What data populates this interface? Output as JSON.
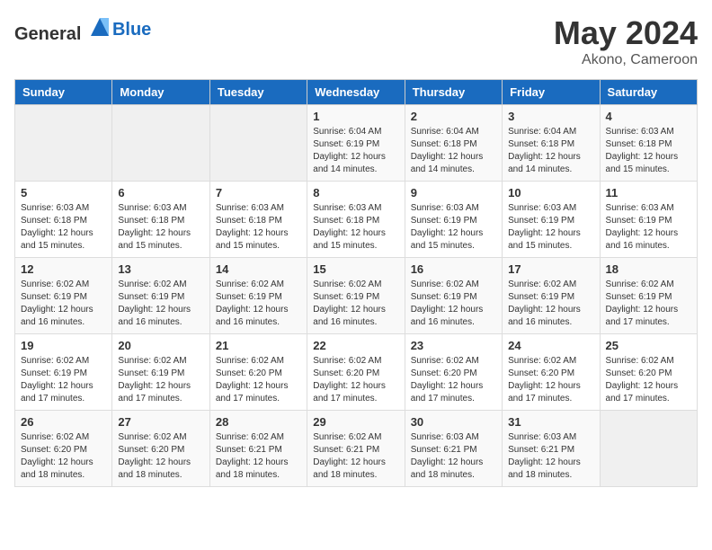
{
  "header": {
    "logo_general": "General",
    "logo_blue": "Blue",
    "month_year": "May 2024",
    "location": "Akono, Cameroon"
  },
  "days_of_week": [
    "Sunday",
    "Monday",
    "Tuesday",
    "Wednesday",
    "Thursday",
    "Friday",
    "Saturday"
  ],
  "weeks": [
    [
      {
        "day": "",
        "info": ""
      },
      {
        "day": "",
        "info": ""
      },
      {
        "day": "",
        "info": ""
      },
      {
        "day": "1",
        "info": "Sunrise: 6:04 AM\nSunset: 6:19 PM\nDaylight: 12 hours\nand 14 minutes."
      },
      {
        "day": "2",
        "info": "Sunrise: 6:04 AM\nSunset: 6:18 PM\nDaylight: 12 hours\nand 14 minutes."
      },
      {
        "day": "3",
        "info": "Sunrise: 6:04 AM\nSunset: 6:18 PM\nDaylight: 12 hours\nand 14 minutes."
      },
      {
        "day": "4",
        "info": "Sunrise: 6:03 AM\nSunset: 6:18 PM\nDaylight: 12 hours\nand 15 minutes."
      }
    ],
    [
      {
        "day": "5",
        "info": "Sunrise: 6:03 AM\nSunset: 6:18 PM\nDaylight: 12 hours\nand 15 minutes."
      },
      {
        "day": "6",
        "info": "Sunrise: 6:03 AM\nSunset: 6:18 PM\nDaylight: 12 hours\nand 15 minutes."
      },
      {
        "day": "7",
        "info": "Sunrise: 6:03 AM\nSunset: 6:18 PM\nDaylight: 12 hours\nand 15 minutes."
      },
      {
        "day": "8",
        "info": "Sunrise: 6:03 AM\nSunset: 6:18 PM\nDaylight: 12 hours\nand 15 minutes."
      },
      {
        "day": "9",
        "info": "Sunrise: 6:03 AM\nSunset: 6:19 PM\nDaylight: 12 hours\nand 15 minutes."
      },
      {
        "day": "10",
        "info": "Sunrise: 6:03 AM\nSunset: 6:19 PM\nDaylight: 12 hours\nand 15 minutes."
      },
      {
        "day": "11",
        "info": "Sunrise: 6:03 AM\nSunset: 6:19 PM\nDaylight: 12 hours\nand 16 minutes."
      }
    ],
    [
      {
        "day": "12",
        "info": "Sunrise: 6:02 AM\nSunset: 6:19 PM\nDaylight: 12 hours\nand 16 minutes."
      },
      {
        "day": "13",
        "info": "Sunrise: 6:02 AM\nSunset: 6:19 PM\nDaylight: 12 hours\nand 16 minutes."
      },
      {
        "day": "14",
        "info": "Sunrise: 6:02 AM\nSunset: 6:19 PM\nDaylight: 12 hours\nand 16 minutes."
      },
      {
        "day": "15",
        "info": "Sunrise: 6:02 AM\nSunset: 6:19 PM\nDaylight: 12 hours\nand 16 minutes."
      },
      {
        "day": "16",
        "info": "Sunrise: 6:02 AM\nSunset: 6:19 PM\nDaylight: 12 hours\nand 16 minutes."
      },
      {
        "day": "17",
        "info": "Sunrise: 6:02 AM\nSunset: 6:19 PM\nDaylight: 12 hours\nand 16 minutes."
      },
      {
        "day": "18",
        "info": "Sunrise: 6:02 AM\nSunset: 6:19 PM\nDaylight: 12 hours\nand 17 minutes."
      }
    ],
    [
      {
        "day": "19",
        "info": "Sunrise: 6:02 AM\nSunset: 6:19 PM\nDaylight: 12 hours\nand 17 minutes."
      },
      {
        "day": "20",
        "info": "Sunrise: 6:02 AM\nSunset: 6:19 PM\nDaylight: 12 hours\nand 17 minutes."
      },
      {
        "day": "21",
        "info": "Sunrise: 6:02 AM\nSunset: 6:20 PM\nDaylight: 12 hours\nand 17 minutes."
      },
      {
        "day": "22",
        "info": "Sunrise: 6:02 AM\nSunset: 6:20 PM\nDaylight: 12 hours\nand 17 minutes."
      },
      {
        "day": "23",
        "info": "Sunrise: 6:02 AM\nSunset: 6:20 PM\nDaylight: 12 hours\nand 17 minutes."
      },
      {
        "day": "24",
        "info": "Sunrise: 6:02 AM\nSunset: 6:20 PM\nDaylight: 12 hours\nand 17 minutes."
      },
      {
        "day": "25",
        "info": "Sunrise: 6:02 AM\nSunset: 6:20 PM\nDaylight: 12 hours\nand 17 minutes."
      }
    ],
    [
      {
        "day": "26",
        "info": "Sunrise: 6:02 AM\nSunset: 6:20 PM\nDaylight: 12 hours\nand 18 minutes."
      },
      {
        "day": "27",
        "info": "Sunrise: 6:02 AM\nSunset: 6:20 PM\nDaylight: 12 hours\nand 18 minutes."
      },
      {
        "day": "28",
        "info": "Sunrise: 6:02 AM\nSunset: 6:21 PM\nDaylight: 12 hours\nand 18 minutes."
      },
      {
        "day": "29",
        "info": "Sunrise: 6:02 AM\nSunset: 6:21 PM\nDaylight: 12 hours\nand 18 minutes."
      },
      {
        "day": "30",
        "info": "Sunrise: 6:03 AM\nSunset: 6:21 PM\nDaylight: 12 hours\nand 18 minutes."
      },
      {
        "day": "31",
        "info": "Sunrise: 6:03 AM\nSunset: 6:21 PM\nDaylight: 12 hours\nand 18 minutes."
      },
      {
        "day": "",
        "info": ""
      }
    ]
  ]
}
